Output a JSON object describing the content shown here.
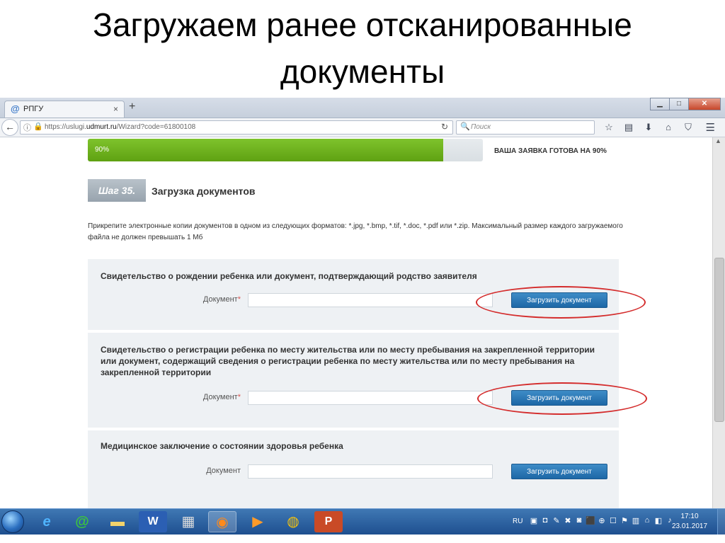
{
  "slide": {
    "title_line1": "Загружаем ранее отсканированные",
    "title_line2": "документы"
  },
  "browser": {
    "tab": {
      "title": "РПГУ",
      "close": "×",
      "icon": "@"
    },
    "new_tab": "+",
    "window_buttons": {
      "minimize": "▁",
      "maximize": "□",
      "close": "✕"
    },
    "url_prefix": "https://uslugi.",
    "url_host": "udmurt.ru",
    "url_path": "/Wizard?code=61800108",
    "search_placeholder": "Поиск",
    "icons": [
      "star-icon",
      "reading-list-icon",
      "download-icon",
      "home-icon",
      "pocket-icon",
      "menu-icon"
    ]
  },
  "page": {
    "progress": {
      "percent_label": "90%",
      "value": 0.9,
      "caption": "ВАША ЗАЯВКА ГОТОВА НА 90%"
    },
    "step": {
      "badge": "Шаг 35.",
      "title": "Загрузка документов"
    },
    "intro": "Прикрепите электронные копии документов в одном из следующих форматов: *.jpg, *.bmp, *.tif, *.doc, *.pdf или *.zip. Максимальный размер каждого загружаемого файла не должен превышать 1 Мб",
    "sections": [
      {
        "title": "Свидетельство о рождении ребенка или документ, подтверждающий родство заявителя",
        "label": "Документ",
        "required": "*",
        "button": "Загрузить документ"
      },
      {
        "title": "Свидетельство о регистрации ребенка по месту жительства или по месту пребывания на закрепленной территории или документ, содержащий сведения о регистрации ребенка по месту жительства или по месту пребывания на закрепленной территории",
        "label": "Документ",
        "required": "*",
        "button": "Загрузить документ"
      },
      {
        "title": "Медицинское заключение о состоянии здоровья ребенка",
        "label": "Документ",
        "required": "",
        "button": "Загрузить документ"
      }
    ]
  },
  "taskbar": {
    "language": "RU",
    "time": "17:10",
    "date": "23.01.2017"
  },
  "colors": {
    "progress_green": "#6ab31f",
    "upload_button": "#2a79b8",
    "annotation_red": "#d42c2c"
  }
}
